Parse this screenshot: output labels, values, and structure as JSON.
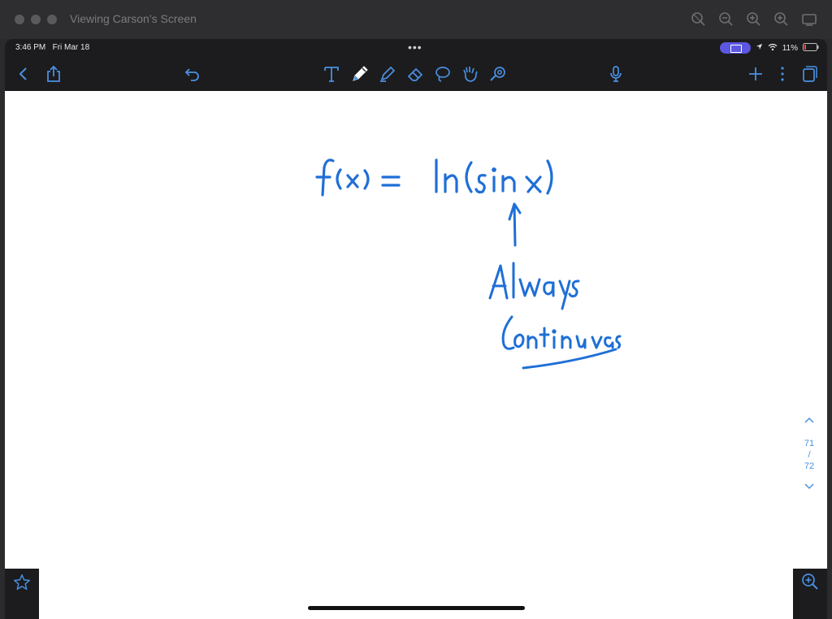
{
  "window": {
    "title": "Viewing Carson’s Screen",
    "zoom_icons": [
      "zoom-reset-icon",
      "zoom-out-icon",
      "zoom-in-icon",
      "zoom-fit-icon",
      "display-icon"
    ]
  },
  "status_bar": {
    "time": "3:46 PM",
    "date": "Fri Mar 18",
    "multitask": "•••",
    "battery": "11%"
  },
  "toolbar": {
    "left": [
      "back-icon",
      "share-icon"
    ],
    "undo": "undo-icon",
    "tools": [
      "text-tool-icon",
      "pen-tool-icon",
      "highlighter-tool-icon",
      "eraser-tool-icon",
      "lasso-tool-icon",
      "shape-tool-icon",
      "laser-pointer-icon"
    ],
    "active_tool": "pen-tool-icon",
    "accent_color": "#4a90e2",
    "right": [
      "microphone-icon",
      "add-icon",
      "more-icon",
      "pages-icon"
    ]
  },
  "note": {
    "handwriting": [
      "f(x) = ln(sin x)",
      "Always",
      "Continuous"
    ],
    "ink_color": "#1f6fd6"
  },
  "pager": {
    "current": "71",
    "separator": "/",
    "total": "72"
  }
}
